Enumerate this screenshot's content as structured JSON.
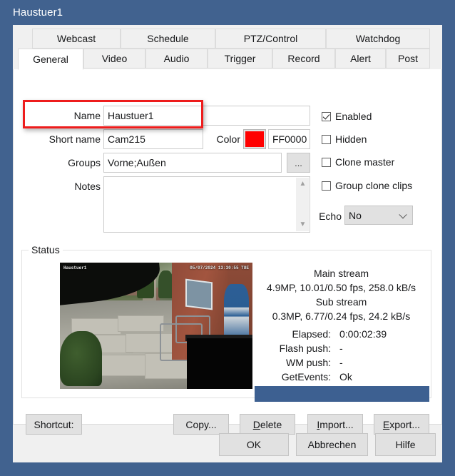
{
  "window": {
    "title": "Haustuer1",
    "titlebar_color": "#41628f"
  },
  "tabs": {
    "row1": [
      {
        "label": "Webcast",
        "selected": false
      },
      {
        "label": "Schedule",
        "selected": false
      },
      {
        "label": "PTZ/Control",
        "selected": false
      },
      {
        "label": "Watchdog",
        "selected": false
      }
    ],
    "row2": [
      {
        "label": "General",
        "selected": true
      },
      {
        "label": "Video",
        "selected": false
      },
      {
        "label": "Audio",
        "selected": false
      },
      {
        "label": "Trigger",
        "selected": false
      },
      {
        "label": "Record",
        "selected": false
      },
      {
        "label": "Alert",
        "selected": false
      },
      {
        "label": "Post",
        "selected": false
      }
    ]
  },
  "form": {
    "name_label": "Name",
    "name_value": "Haustuer1",
    "short_name_label": "Short name",
    "short_name_value": "Cam215",
    "color_label": "Color",
    "color_hex_value": "FF0000",
    "color_swatch": "#FF0000",
    "groups_label": "Groups",
    "groups_value": "Vorne;Außen",
    "groups_browse_label": "...",
    "notes_label": "Notes",
    "notes_value": ""
  },
  "options": {
    "checkboxes": [
      {
        "label": "Enabled",
        "checked": true
      },
      {
        "label": "Hidden",
        "checked": false
      },
      {
        "label": "Clone master",
        "checked": false
      },
      {
        "label": "Group clone clips",
        "checked": false
      }
    ],
    "echo_label": "Echo",
    "echo_value": "No"
  },
  "status": {
    "group_title": "Status",
    "preview": {
      "osd_camera_name": "Haustuer1",
      "osd_timestamp": "05/07/2024 13:30:55 TUE"
    },
    "main_stream_title": "Main stream",
    "main_stream_detail": "4.9MP, 10.01/0.50 fps,  258.0 kB/s",
    "sub_stream_title": "Sub stream",
    "sub_stream_detail": "0.3MP,  6.77/0.24 fps,   24.2 kB/s",
    "rows": [
      {
        "label": "Elapsed:",
        "value": "0:00:02:39"
      },
      {
        "label": "Flash push:",
        "value": "-"
      },
      {
        "label": "WM push:",
        "value": "-"
      },
      {
        "label": "GetEvents:",
        "value": "Ok"
      }
    ],
    "progress_color": "#3d6091"
  },
  "actions": {
    "shortcut": "Shortcut:",
    "copy": "Copy...",
    "delete": "Delete",
    "delete_mnemonic": "D",
    "delete_rest": "elete",
    "import": "Import...",
    "import_mnemonic": "I",
    "import_rest": "mport...",
    "export": "Export...",
    "export_mnemonic": "E",
    "export_rest": "xport..."
  },
  "dialog_buttons": {
    "ok": "OK",
    "cancel": "Abbrechen",
    "help": "Hilfe"
  }
}
